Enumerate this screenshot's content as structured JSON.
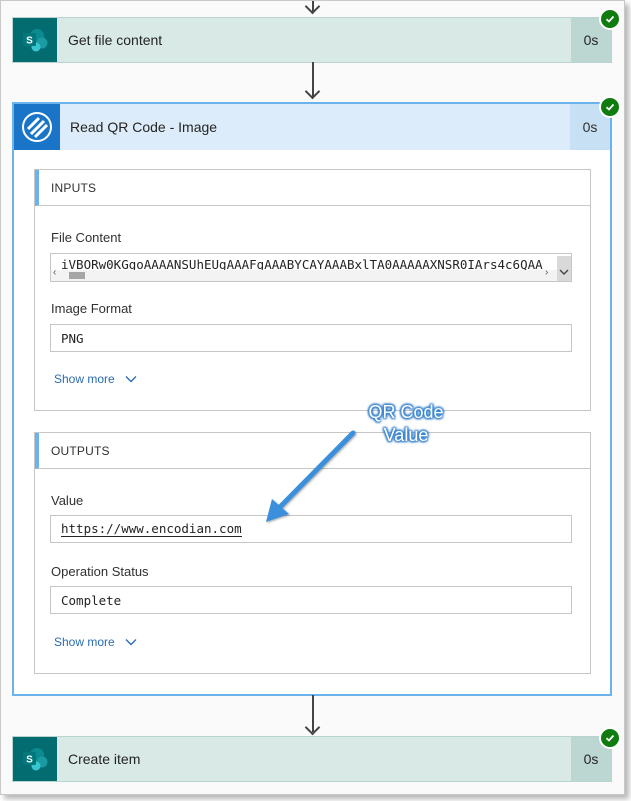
{
  "steps": {
    "get_file": {
      "title": "Get file content",
      "duration": "0s",
      "icon": "sharepoint-icon"
    },
    "read_qr": {
      "title": "Read QR Code - Image",
      "duration": "0s",
      "icon": "encodian-icon"
    },
    "create_item": {
      "title": "Create item",
      "duration": "0s",
      "icon": "sharepoint-icon"
    }
  },
  "inputs": {
    "header": "INPUTS",
    "file_content_label": "File Content",
    "file_content_value": "iVBORw0KGgoAAAANSUhEUgAAAFgAAABYCAYAAABxlTA0AAAAAXNSR0IArs4c6QAA",
    "image_format_label": "Image Format",
    "image_format_value": "PNG",
    "show_more": "Show more"
  },
  "outputs": {
    "header": "OUTPUTS",
    "value_label": "Value",
    "value_value": "https://www.encodian.com",
    "status_label": "Operation Status",
    "status_value": "Complete",
    "show_more": "Show more"
  },
  "annotation": {
    "line1": "QR Code",
    "line2": "Value"
  },
  "colors": {
    "success": "#107c10",
    "sharepoint": "#036c70",
    "encodian": "#1a75c9",
    "callout": "#3a8fdb"
  }
}
